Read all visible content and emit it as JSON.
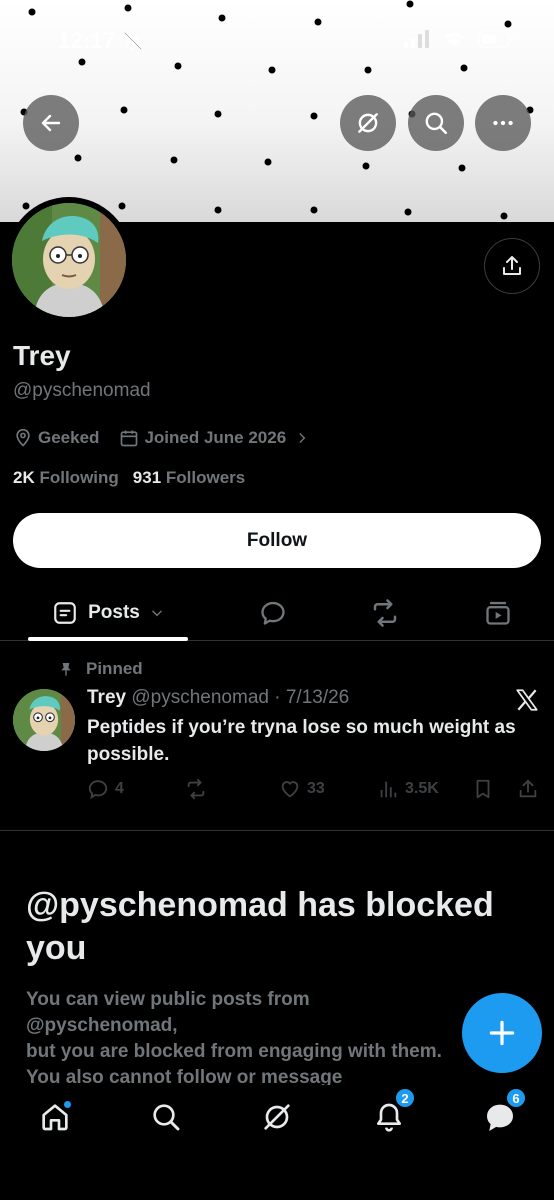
{
  "status_bar": {
    "time": "12:17"
  },
  "profile": {
    "name": "Trey",
    "handle": "@pyschenomad",
    "location": "Geeked",
    "joined": "Joined June 2026",
    "following_count": "2K",
    "following_label": "Following",
    "followers_count": "931",
    "followers_label": "Followers",
    "follow_button": "Follow"
  },
  "tabs": {
    "posts_label": "Posts"
  },
  "pinned_post": {
    "pinned_label": "Pinned",
    "author_name": "Trey",
    "author_handle_date": "@pyschenomad · 7/13/26",
    "text": "Peptides if you’re tryna lose so much weight as possible.",
    "replies": "4",
    "likes": "33",
    "views": "3.5K"
  },
  "blocked": {
    "title": "@pyschenomad has blocked you",
    "body": "You can view public posts from @pyschenomad,\nbut you are blocked from engaging with them.\nYou also cannot follow or message\n@pyschenomad."
  },
  "bottom_nav": {
    "notifications_badge": "2",
    "messages_badge": "6"
  },
  "colors": {
    "accent": "#1d9bf0",
    "background": "#000000",
    "secondary_text": "#71767b"
  }
}
